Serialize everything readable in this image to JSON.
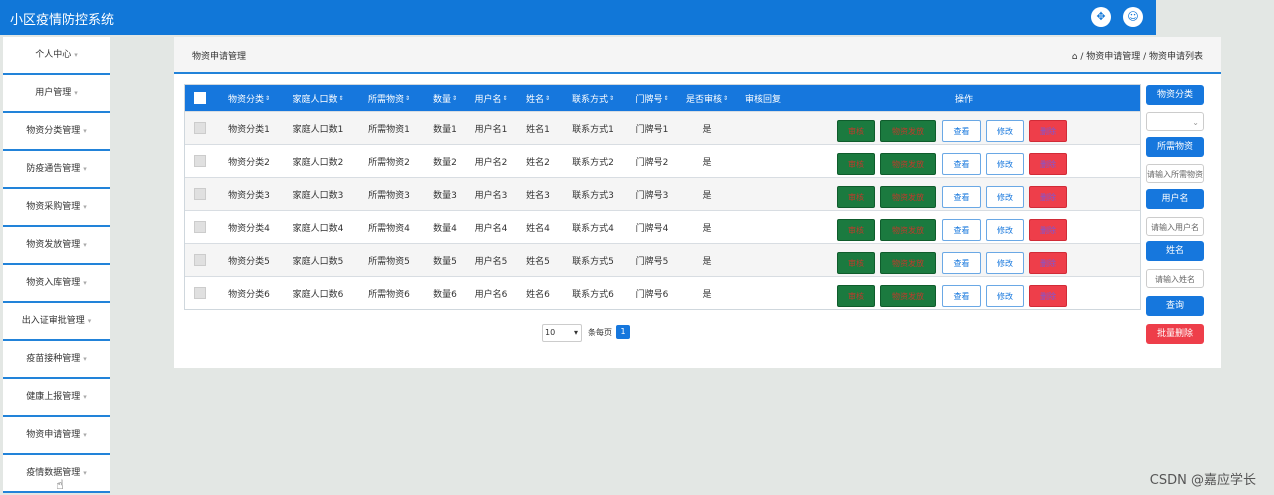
{
  "app": {
    "title": "小区疫情防控系统"
  },
  "top_icons": {
    "fullscreen": "fullscreen-icon",
    "user": "user-icon"
  },
  "sidebar": {
    "items": [
      {
        "label": "个人中心"
      },
      {
        "label": "用户管理"
      },
      {
        "label": "物资分类管理"
      },
      {
        "label": "防疫通告管理"
      },
      {
        "label": "物资采购管理"
      },
      {
        "label": "物资发放管理"
      },
      {
        "label": "物资入库管理"
      },
      {
        "label": "出入证审批管理"
      },
      {
        "label": "疫苗接种管理"
      },
      {
        "label": "健康上报管理"
      },
      {
        "label": "物资申请管理"
      },
      {
        "label": "疫情数据管理"
      }
    ]
  },
  "header": {
    "title": "物资申请管理",
    "breadcrumb": "/ 物资申请管理 / 物资申请列表"
  },
  "table": {
    "columns": [
      "物资分类",
      "家庭人口数",
      "所需物资",
      "数量",
      "用户名",
      "姓名",
      "联系方式",
      "门牌号",
      "是否审核",
      "审核回复",
      "操作"
    ],
    "rows": [
      [
        "物资分类1",
        "家庭人口数1",
        "所需物资1",
        "数量1",
        "用户名1",
        "姓名1",
        "联系方式1",
        "门牌号1",
        "是"
      ],
      [
        "物资分类2",
        "家庭人口数2",
        "所需物资2",
        "数量2",
        "用户名2",
        "姓名2",
        "联系方式2",
        "门牌号2",
        "是"
      ],
      [
        "物资分类3",
        "家庭人口数3",
        "所需物资3",
        "数量3",
        "用户名3",
        "姓名3",
        "联系方式3",
        "门牌号3",
        "是"
      ],
      [
        "物资分类4",
        "家庭人口数4",
        "所需物资4",
        "数量4",
        "用户名4",
        "姓名4",
        "联系方式4",
        "门牌号4",
        "是"
      ],
      [
        "物资分类5",
        "家庭人口数5",
        "所需物资5",
        "数量5",
        "用户名5",
        "姓名5",
        "联系方式5",
        "门牌号5",
        "是"
      ],
      [
        "物资分类6",
        "家庭人口数6",
        "所需物资6",
        "数量6",
        "用户名6",
        "姓名6",
        "联系方式6",
        "门牌号6",
        "是"
      ]
    ],
    "actions": {
      "audit": "审核",
      "payment": "物资发放",
      "view": "查看",
      "edit": "修改",
      "delete": "删除"
    }
  },
  "pagination": {
    "page_size": "10",
    "per_page_label": "条每页",
    "current_page": "1"
  },
  "filters": {
    "category_label": "物资分类",
    "needed_label": "所需物资",
    "needed_placeholder": "请输入所需物资",
    "username_label": "用户名",
    "username_placeholder": "请输入用户名",
    "name_label": "姓名",
    "name_placeholder": "请输入姓名",
    "search_button": "查询",
    "batch_delete_button": "批量删除"
  },
  "watermark": "CSDN @嘉应学长"
}
